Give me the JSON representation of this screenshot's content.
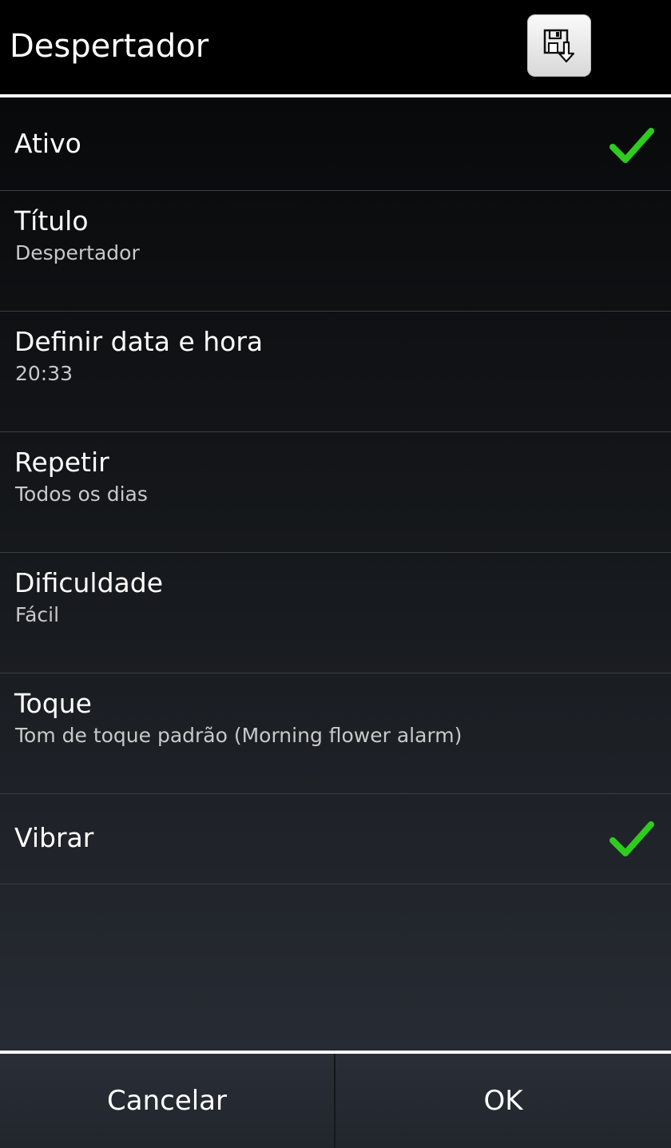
{
  "header": {
    "title": "Despertador",
    "save_icon": "save-icon"
  },
  "settings": [
    {
      "title": "Ativo",
      "checked": true
    },
    {
      "title": "Título",
      "value": "Despertador"
    },
    {
      "title": "Definir data e hora",
      "value": "20:33"
    },
    {
      "title": "Repetir",
      "value": "Todos os dias"
    },
    {
      "title": "Dificuldade",
      "value": "Fácil"
    },
    {
      "title": "Toque",
      "value": "Tom de toque padrão (Morning flower alarm)"
    },
    {
      "title": "Vibrar",
      "checked": true
    }
  ],
  "buttons": {
    "cancel": "Cancelar",
    "ok": "OK"
  },
  "colors": {
    "check": "#2ecc1f",
    "background": "#000000",
    "divider": "#ffffff"
  }
}
